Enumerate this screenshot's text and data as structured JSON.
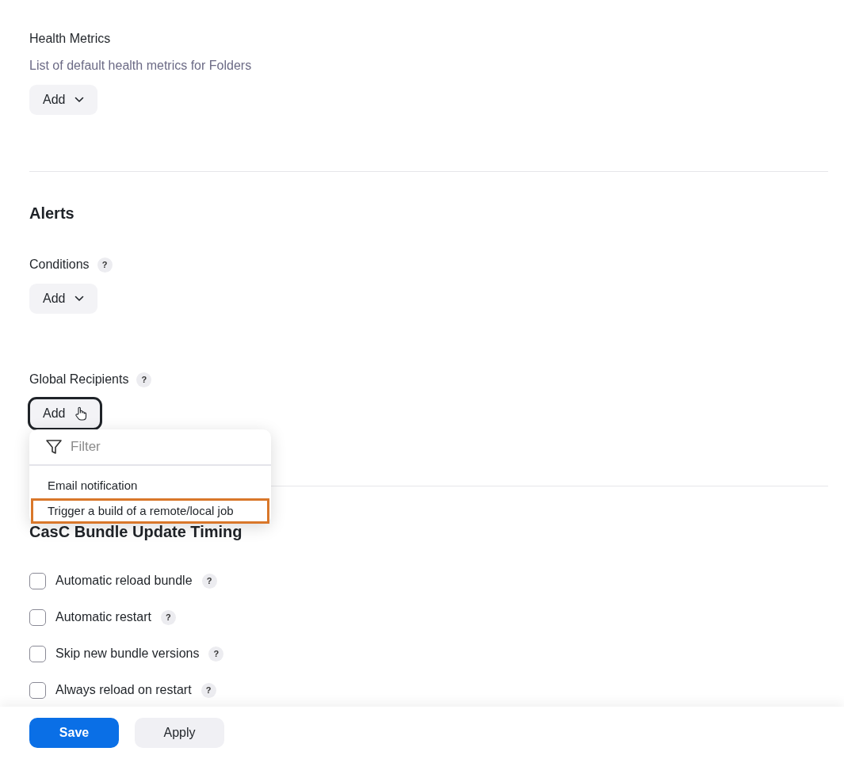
{
  "health_metrics": {
    "label": "Health Metrics",
    "description": "List of default health metrics for Folders",
    "add_button": {
      "label": "Add",
      "focused": false
    }
  },
  "alerts": {
    "heading": "Alerts",
    "fields": [
      {
        "label": "Conditions",
        "help": "?",
        "add_button": {
          "label": "Add",
          "focused": false
        }
      },
      {
        "label": "Global Recipients",
        "help": "?",
        "add_button": {
          "label": "Add",
          "focused": true
        }
      }
    ]
  },
  "dropdown_menu": {
    "filter_placeholder": "Filter",
    "items": [
      {
        "label": "Email notification",
        "highlighted": false
      },
      {
        "label": "Trigger a build of a remote/local job",
        "highlighted": true
      }
    ]
  },
  "casc_bundle": {
    "heading": "CasC Bundle Update Timing",
    "options": [
      {
        "label": "Automatic reload bundle",
        "help": "?",
        "checked": false
      },
      {
        "label": "Automatic restart",
        "help": "?",
        "checked": false
      },
      {
        "label": "Skip new bundle versions",
        "help": "?",
        "checked": false
      },
      {
        "label": "Always reload on restart",
        "help": "?",
        "checked": false
      }
    ]
  },
  "footer": {
    "buttons": [
      {
        "label": "Save",
        "kind": "primary"
      },
      {
        "label": "Apply",
        "kind": "secondary"
      }
    ]
  }
}
